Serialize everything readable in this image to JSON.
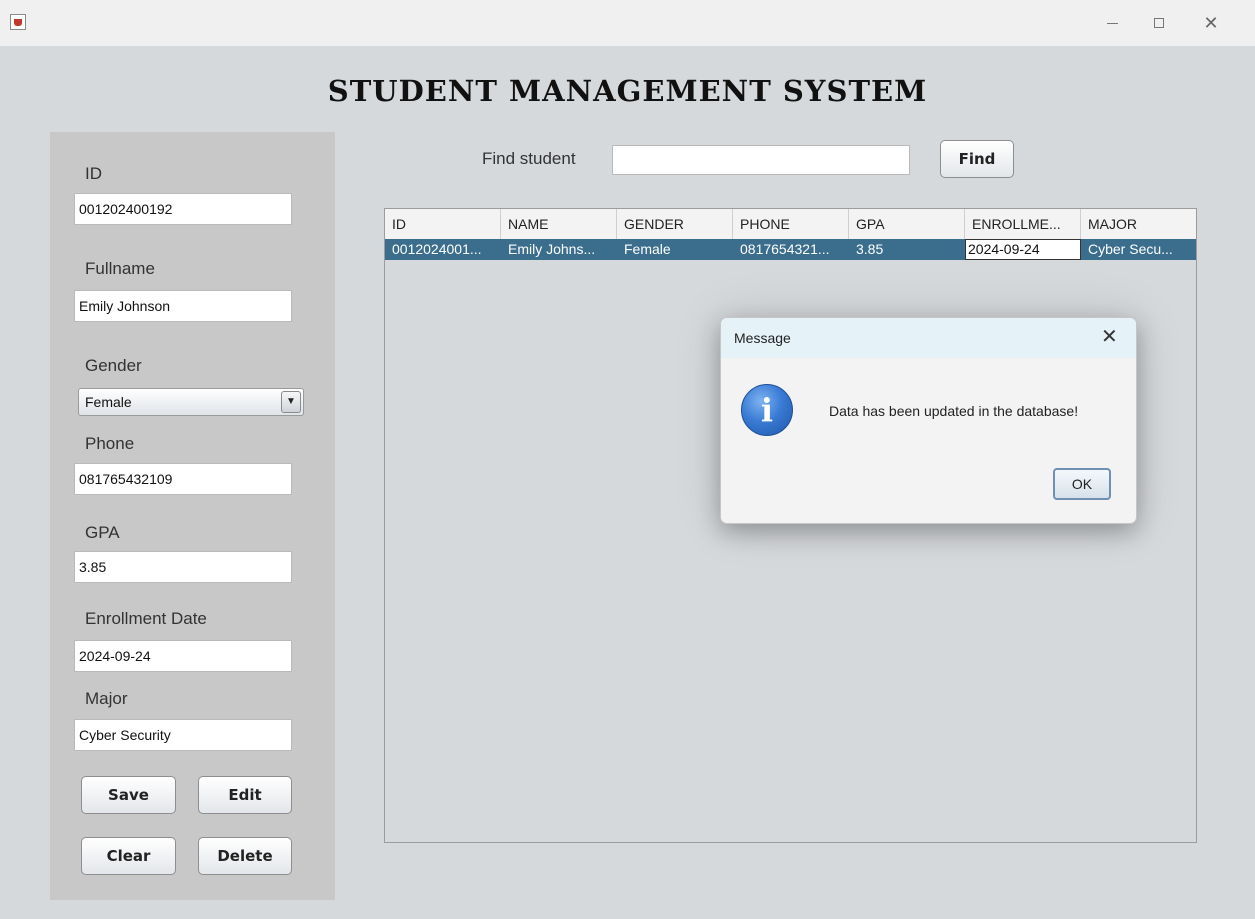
{
  "app": {
    "title": "STUDENT MANAGEMENT SYSTEM"
  },
  "window_controls": {
    "minimize": "—",
    "maximize": "□",
    "close": "✕"
  },
  "form": {
    "id_label": "ID",
    "id_value": "001202400192",
    "fullname_label": "Fullname",
    "fullname_value": "Emily Johnson",
    "gender_label": "Gender",
    "gender_value": "Female",
    "phone_label": "Phone",
    "phone_value": "081765432109",
    "gpa_label": "GPA",
    "gpa_value": "3.85",
    "enrollment_label": "Enrollment Date",
    "enrollment_value": "2024-09-24",
    "major_label": "Major",
    "major_value": "Cyber Security",
    "buttons": {
      "save": "Save",
      "edit": "Edit",
      "clear": "Clear",
      "delete": "Delete"
    }
  },
  "search": {
    "label": "Find student",
    "value": "",
    "button": "Find"
  },
  "table": {
    "headers": [
      "ID",
      "NAME",
      "GENDER",
      "PHONE",
      "GPA",
      "ENROLLME...",
      "MAJOR"
    ],
    "rows": [
      [
        "0012024001...",
        "Emily Johns...",
        "Female",
        "0817654321...",
        "3.85",
        "2024-09-24",
        "Cyber Secu..."
      ]
    ],
    "selected_row": 0
  },
  "dialog": {
    "title": "Message",
    "close": "✕",
    "icon": "info-icon",
    "icon_glyph": "i",
    "message": "Data has been updated in the database!",
    "ok": "OK"
  },
  "colors": {
    "background": "#d6d9dc",
    "panel": "#c8c8c8",
    "selected_row": "#3b6e8d",
    "dialog_header": "#e5f2f7"
  }
}
